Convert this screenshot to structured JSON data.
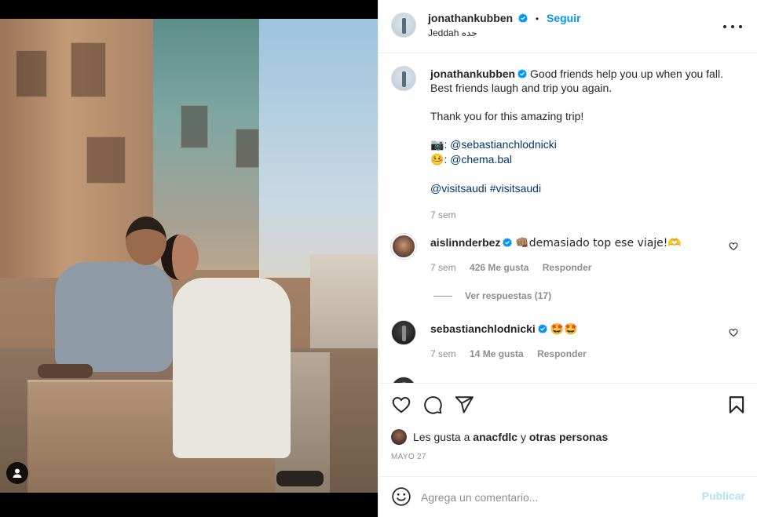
{
  "post": {
    "author": "jonathankubben",
    "follow_label": "Seguir",
    "separator": "•",
    "location": "Jeddah جده",
    "caption_line1": "Good friends help you up when you fall.",
    "caption_line2": "Best friends laugh and trip you again.",
    "caption_line3": "Thank you for this amazing trip!",
    "credit1_icon": "📷",
    "credit1_sep": ":",
    "credit1_handle": "@sebastianchlodnicki",
    "credit2_icon": "🤒",
    "credit2_sep": ":",
    "credit2_handle": "@chema.bal",
    "tags_handle": "@visitsaudi",
    "tags_hashtag": "#visitsaudi",
    "time": "7 sem"
  },
  "comments": [
    {
      "user": "aislinnderbez",
      "text": "👊🏽demasiado top ese viaje!🫶",
      "time": "7 sem",
      "likes": "426 Me gusta",
      "reply_label": "Responder",
      "view_replies": "Ver respuestas (17)"
    },
    {
      "user": "sebastianchlodnicki",
      "text": "🤩🤩",
      "time": "7 sem",
      "likes": "14 Me gusta",
      "reply_label": "Responder"
    }
  ],
  "likes_summary": {
    "prefix": "Les gusta a",
    "user": "anacfdlc",
    "joiner": "y",
    "others": "otras personas"
  },
  "date": "MAYO 27",
  "comment_box": {
    "placeholder": "Agrega un comentario...",
    "post_label": "Publicar"
  },
  "colors": {
    "accent": "#0095f6",
    "link": "#00376b",
    "muted": "#8e8e8e",
    "post_disabled": "#b2dffc"
  },
  "icons": [
    "more-options-icon",
    "verified-badge-icon",
    "heart-icon",
    "comment-icon",
    "share-icon",
    "bookmark-icon",
    "emoji-icon",
    "user-tag-icon"
  ]
}
